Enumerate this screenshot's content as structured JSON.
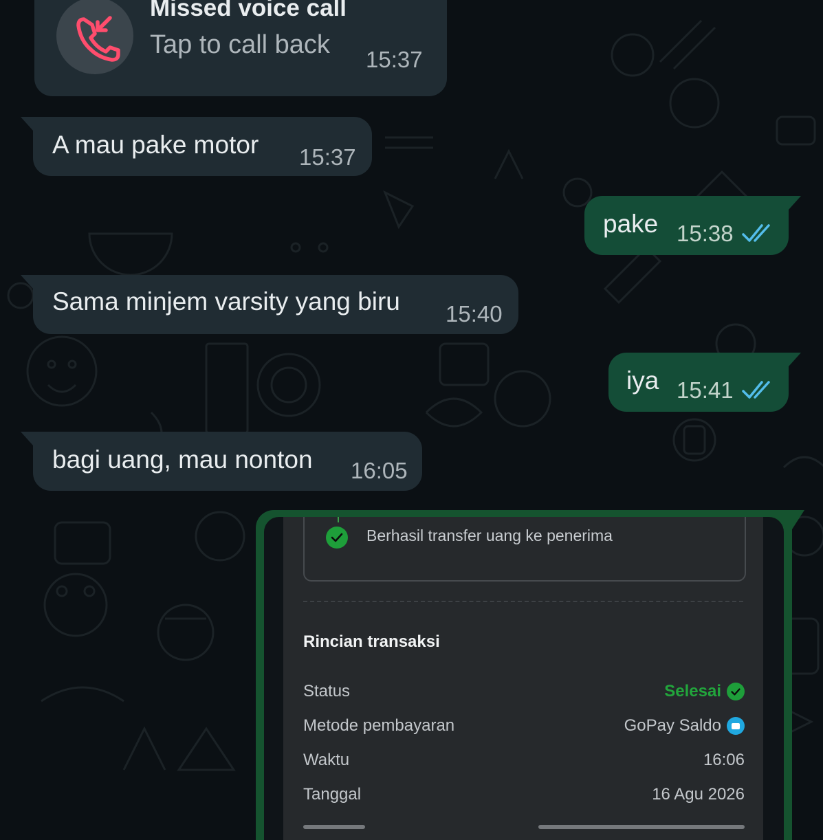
{
  "missed_call": {
    "icon": "missed-call-icon",
    "title": "Missed voice call",
    "subtitle": "Tap to call back",
    "time": "15:37",
    "icon_color": "#ff4d6d"
  },
  "messages": [
    {
      "direction": "incoming",
      "text": "A mau pake motor",
      "time": "15:37"
    },
    {
      "direction": "outgoing",
      "text": "pake",
      "time": "15:38",
      "status_icon": "double-check-icon"
    },
    {
      "direction": "incoming",
      "text": "Sama minjem varsity yang biru",
      "time": "15:40"
    },
    {
      "direction": "outgoing",
      "text": "iya",
      "time": "15:41",
      "status_icon": "double-check-icon"
    },
    {
      "direction": "incoming",
      "text": "bagi uang, mau nonton",
      "time": "16:05"
    }
  ],
  "transfer_screenshot": {
    "step_text": "Berhasil transfer uang ke penerima",
    "section_title": "Rincian transaksi",
    "rows": [
      {
        "label": "Status",
        "value": "Selesai",
        "icon": "check-circle-icon"
      },
      {
        "label": "Metode pembayaran",
        "value": "GoPay Saldo",
        "icon": "gopay-wallet-icon"
      },
      {
        "label": "Waktu",
        "value": "16:06"
      },
      {
        "label": "Tanggal",
        "value": "16 Agu 2026"
      }
    ]
  },
  "colors": {
    "incoming_bubble": "#202c33",
    "outgoing_bubble": "#144d37",
    "read_ticks": "#53bdeb",
    "success_green": "#22a53c"
  }
}
